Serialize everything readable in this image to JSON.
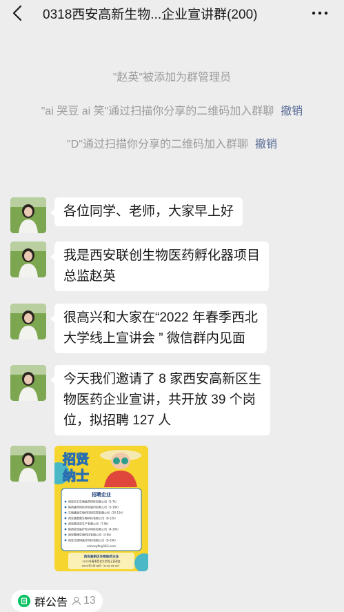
{
  "header": {
    "title": "0318西安高新生物...企业宣讲群(200)"
  },
  "system_messages": [
    {
      "text": "\"赵英\"被添加为群管理员",
      "action": ""
    },
    {
      "text": "\"ai 哭豆 ai 笑\"通过扫描你分享的二维码加入群聊",
      "action": "撤销"
    },
    {
      "text": "\"D\"通过扫描你分享的二维码加入群聊",
      "action": "撤销"
    }
  ],
  "messages": [
    {
      "lines": [
        "各位同学、老师，大家早上好"
      ]
    },
    {
      "lines": [
        "我是西安联创生物医药孵化器项目",
        "总监赵英"
      ]
    },
    {
      "lines": [
        "很高兴和大家在“2022 年春季西北",
        "大学线上宣讲会 ” 微信群内见面"
      ]
    },
    {
      "lines": [
        "今天我们邀请了 8 家西安高新区生",
        "物医药企业宣讲，共开放 39 个岗",
        "位，拟招聘 127 人"
      ]
    }
  ],
  "poster": {
    "headline_1": "招贤",
    "headline_2": "纳士",
    "section": "招聘企业",
    "companies": [
      "西安京卫生物医药科技有限公司（5-7k）",
      "陕西盛世科技研究股份有限公司（5-10k）",
      "生物基础生物科技研究院有限公司（10-15k）",
      "西安盛鼎隆生物科技有限公司（8-12k）",
      "西安欧诺克生产有限公司（7-8k）",
      "陕西发现医疗电子科技有限公司（4-10k）",
      "西安惠德生物科技有限公司（4-8k）",
      "西安正维特医疗科技有限公司（6-10k）"
    ],
    "email": "sdcswyfh@163.com",
    "footer_1": "西安高新区生物医药企业",
    "footer_2": "2022年春季西北大学线上宣讲会",
    "footer_3": "2022年3月18日（9:30-16:30）"
  },
  "bottom": {
    "notice_label": "群公告",
    "member_count": "13"
  },
  "colors": {
    "background": "#ededed",
    "link": "#576b95",
    "system_text": "#9b9b9b",
    "poster_yellow": "#f6d62e",
    "notice_icon": "#07c160"
  }
}
